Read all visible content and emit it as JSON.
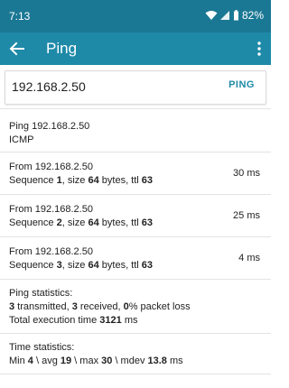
{
  "status_bar": {
    "time": "7:13",
    "battery": "82%"
  },
  "app_bar": {
    "title": "Ping"
  },
  "input": {
    "value": "192.168.2.50",
    "button_label": "PING"
  },
  "header_block": {
    "line1": "Ping 192.168.2.50",
    "line2": "ICMP"
  },
  "replies": [
    {
      "from": "From 192.168.2.50",
      "seq_label": "Sequence ",
      "seq": "1",
      "size_label": ", size ",
      "size": "64",
      "bytes_label": " bytes, ttl ",
      "ttl": "63",
      "time": "30 ms"
    },
    {
      "from": "From 192.168.2.50",
      "seq_label": "Sequence ",
      "seq": "2",
      "size_label": ", size ",
      "size": "64",
      "bytes_label": " bytes, ttl ",
      "ttl": "63",
      "time": "25 ms"
    },
    {
      "from": "From 192.168.2.50",
      "seq_label": "Sequence ",
      "seq": "3",
      "size_label": ", size ",
      "size": "64",
      "bytes_label": " bytes, ttl ",
      "ttl": "63",
      "time": "4 ms"
    }
  ],
  "ping_stats": {
    "heading": "Ping statistics:",
    "transmitted": "3",
    "transmitted_label": " transmitted, ",
    "received": "3",
    "received_label": " received, ",
    "loss": "0",
    "loss_label": "% packet loss",
    "exec_label": "Total execution time ",
    "exec_time": "3121",
    "exec_unit": " ms"
  },
  "time_stats": {
    "heading": "Time statistics:",
    "min_label": "Min ",
    "min": "4",
    "avg_label": " \\ avg ",
    "avg": "19",
    "max_label": " \\ max ",
    "max": "30",
    "mdev_label": " \\ mdev ",
    "mdev": "13.8",
    "unit": " ms"
  }
}
